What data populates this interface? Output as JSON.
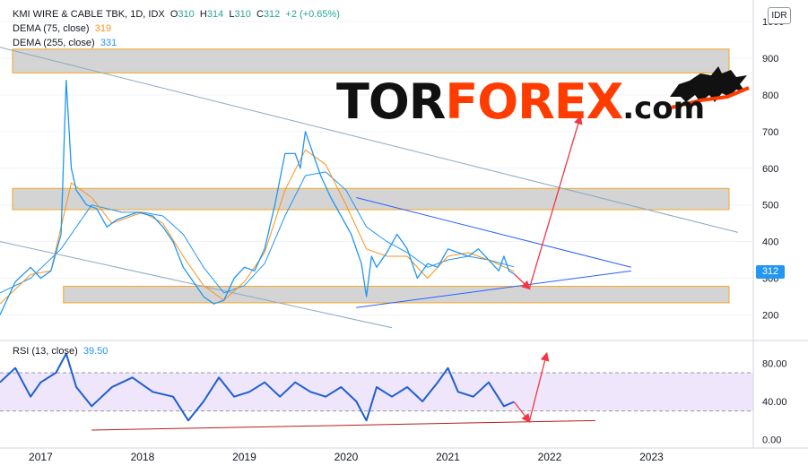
{
  "legend": {
    "symbol": "KMI WIRE & CABLE TBK, 1D, IDX",
    "o_label": "O",
    "o_value": "310",
    "h_label": "H",
    "h_value": "314",
    "l_label": "L",
    "l_value": "310",
    "c_label": "C",
    "c_value": "312",
    "change": "+2 (+0.65%)",
    "dema75_label": "DEMA (75, close)",
    "dema75_value": "319",
    "dema255_label": "DEMA (255, close)",
    "dema255_value": "331"
  },
  "currency_button": "IDR",
  "last_price_tag": "312",
  "logo": {
    "part1": "TOR",
    "part2": "FOREX",
    "part3": ".com"
  },
  "rsi_legend": {
    "label": "RSI (13, close)",
    "value": "39.50"
  },
  "colors": {
    "price_line": "#2196f3",
    "dema75": "#f7931a",
    "dema255": "#2196f3",
    "rsi_line": "#1e5fd1",
    "rsi_band": "#efe6fb",
    "zone_fill": "#d4d4d4",
    "zone_border": "#f5a623",
    "arrow": "#f23645"
  },
  "chart_data": [
    {
      "type": "line",
      "series_label": "KMI WIRE & CABLE TBK, 1D, IDX",
      "y_ticks": [
        200,
        300,
        400,
        500,
        600,
        700,
        800,
        900,
        1000
      ],
      "ylim": [
        140,
        1010
      ],
      "xlim": [
        2016.6,
        2024.0
      ],
      "x_ticks": [
        "2017",
        "2018",
        "2019",
        "2020",
        "2021",
        "2022",
        "2023"
      ],
      "price_close_approx": {
        "x": [
          2016.6,
          2016.75,
          2016.9,
          2017.0,
          2017.1,
          2017.2,
          2017.25,
          2017.3,
          2017.35,
          2017.45,
          2017.55,
          2017.65,
          2017.75,
          2017.85,
          2017.95,
          2018.1,
          2018.2,
          2018.3,
          2018.4,
          2018.5,
          2018.6,
          2018.7,
          2018.8,
          2018.9,
          2019.0,
          2019.1,
          2019.2,
          2019.3,
          2019.4,
          2019.5,
          2019.55,
          2019.6,
          2019.65,
          2019.7,
          2019.75,
          2019.85,
          2019.95,
          2020.05,
          2020.15,
          2020.2,
          2020.25,
          2020.3,
          2020.4,
          2020.5,
          2020.6,
          2020.7,
          2020.8,
          2020.9,
          2021.0,
          2021.1,
          2021.2,
          2021.3,
          2021.4,
          2021.5,
          2021.55,
          2021.6,
          2021.65
        ],
        "y": [
          200,
          290,
          330,
          300,
          320,
          420,
          840,
          600,
          540,
          500,
          490,
          440,
          460,
          470,
          480,
          470,
          440,
          400,
          330,
          290,
          250,
          230,
          240,
          300,
          330,
          320,
          380,
          500,
          640,
          640,
          600,
          700,
          660,
          620,
          580,
          520,
          470,
          420,
          340,
          250,
          360,
          330,
          370,
          420,
          380,
          300,
          340,
          330,
          380,
          370,
          360,
          380,
          350,
          320,
          360,
          320,
          312
        ]
      },
      "dema75_approx": {
        "x": [
          2016.6,
          2016.9,
          2017.1,
          2017.3,
          2017.5,
          2017.7,
          2018.0,
          2018.2,
          2018.4,
          2018.6,
          2018.8,
          2019.0,
          2019.2,
          2019.4,
          2019.6,
          2019.8,
          2020.0,
          2020.2,
          2020.4,
          2020.6,
          2020.8,
          2021.0,
          2021.2,
          2021.4,
          2021.65
        ],
        "y": [
          230,
          310,
          320,
          560,
          520,
          450,
          480,
          450,
          360,
          280,
          240,
          290,
          370,
          540,
          650,
          610,
          500,
          380,
          360,
          360,
          300,
          360,
          370,
          350,
          319
        ]
      },
      "dema255_approx": {
        "x": [
          2016.6,
          2016.9,
          2017.2,
          2017.5,
          2017.8,
          2018.0,
          2018.2,
          2018.4,
          2018.6,
          2018.8,
          2019.0,
          2019.2,
          2019.4,
          2019.6,
          2019.8,
          2020.0,
          2020.2,
          2020.4,
          2020.6,
          2020.8,
          2021.0,
          2021.2,
          2021.4,
          2021.65
        ],
        "y": [
          260,
          300,
          380,
          500,
          480,
          480,
          470,
          420,
          330,
          260,
          280,
          340,
          470,
          580,
          590,
          540,
          440,
          400,
          370,
          330,
          350,
          360,
          350,
          331
        ]
      },
      "annotations": {
        "horizontal_zones": [
          {
            "y_range": [
              860,
              925
            ],
            "x_range": [
              2016.6,
              2023.85
            ]
          },
          {
            "y_range": [
              487,
              545
            ],
            "x_range": [
              2016.6,
              2023.85
            ]
          },
          {
            "y_range": [
              233,
              278
            ],
            "x_range": [
              2017.1,
              2023.85
            ]
          }
        ],
        "trendlines": [
          {
            "from": [
              2016.6,
              930
            ],
            "to": [
              2023.85,
              425
            ]
          },
          {
            "from": [
              2016.6,
              400
            ],
            "to": [
              2020.45,
              165
            ]
          },
          {
            "from": [
              2020.1,
              220
            ],
            "to": [
              2022.8,
              320
            ]
          },
          {
            "from": [
              2020.1,
              520
            ],
            "to": [
              2022.8,
              330
            ]
          }
        ],
        "arrows": [
          {
            "from": [
              2021.65,
              312
            ],
            "to": [
              2021.8,
              272
            ]
          },
          {
            "from": [
              2021.8,
              272
            ],
            "to": [
              2022.3,
              740
            ]
          }
        ]
      }
    },
    {
      "type": "line",
      "series_name": "RSI (13, close)",
      "y_ticks": [
        0.0,
        40.0,
        80.0
      ],
      "ylim": [
        -5,
        100
      ],
      "band": [
        30,
        70
      ],
      "rsi_approx": {
        "x": [
          2016.6,
          2016.75,
          2016.9,
          2017.0,
          2017.15,
          2017.25,
          2017.35,
          2017.5,
          2017.7,
          2017.9,
          2018.1,
          2018.3,
          2018.45,
          2018.6,
          2018.75,
          2018.9,
          2019.05,
          2019.2,
          2019.35,
          2019.5,
          2019.65,
          2019.8,
          2019.95,
          2020.1,
          2020.2,
          2020.3,
          2020.45,
          2020.6,
          2020.75,
          2020.9,
          2021.0,
          2021.1,
          2021.25,
          2021.4,
          2021.55,
          2021.65
        ],
        "y": [
          60,
          75,
          45,
          60,
          70,
          90,
          55,
          35,
          55,
          65,
          50,
          45,
          20,
          40,
          65,
          45,
          50,
          60,
          45,
          60,
          50,
          45,
          55,
          40,
          20,
          55,
          45,
          55,
          40,
          60,
          75,
          50,
          45,
          60,
          35,
          39.5
        ]
      },
      "annotations": {
        "trendlines": [
          {
            "from": [
              2017.5,
              10
            ],
            "to": [
              2022.45,
              20
            ]
          }
        ],
        "arrows": [
          {
            "from": [
              2021.65,
              39.5
            ],
            "to": [
              2021.8,
              19
            ]
          },
          {
            "from": [
              2021.8,
              19
            ],
            "to": [
              2021.97,
              90
            ]
          }
        ]
      }
    }
  ]
}
